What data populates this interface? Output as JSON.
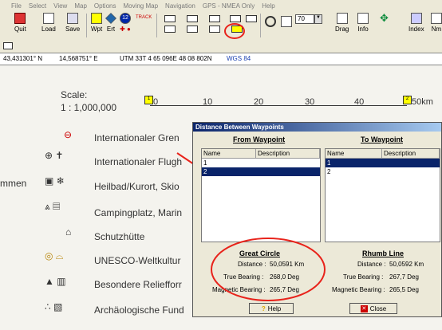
{
  "menu": [
    "File",
    "Select",
    "View",
    "Map",
    "Options",
    "Moving Map",
    "Navigation",
    "GPS - NMEA Only",
    "Help"
  ],
  "toolbar": {
    "quit": "Quit",
    "load": "Load",
    "save": "Save",
    "wpt": "Wpt",
    "ert": "Ert",
    "rte_num": "12",
    "track": "TRACK",
    "zoom": "70",
    "drag": "Drag",
    "info": "Info",
    "index": "Index",
    "nm": "Nm"
  },
  "status": {
    "lat": "43,431301° N",
    "lon": "14,568751° E",
    "utm": "UTM  33T   4 65 096E   48 08 802N",
    "datum": "WGS 84"
  },
  "map": {
    "scale_label": "Scale:",
    "scale_value": "1 : 1,000,000",
    "ruler": [
      "0",
      "10",
      "20",
      "30",
      "40",
      "50km"
    ],
    "left_cut": "mmen",
    "legend": [
      "Internationaler Gren",
      "Internationaler Flugh",
      "Heilbad/Kurort, Skio",
      "Campingplatz, Marin",
      "Schutzhütte",
      "UNESCO-Weltkultur",
      "Besondere Reliefforr",
      "Archäologische Fund"
    ]
  },
  "dialog": {
    "title": "Distance Between Waypoints",
    "from_title": "From Waypoint",
    "to_title": "To Waypoint",
    "col_name": "Name",
    "col_desc": "Description",
    "from_rows": [
      "1",
      "2"
    ],
    "to_rows": [
      "1",
      "2"
    ],
    "great_circle": {
      "title": "Great Circle",
      "distance_label": "Distance :",
      "distance": "50,0591 Km",
      "true_label": "True Bearing :",
      "true": "268,0 Deg",
      "mag_label": "Magnetic Bearing :",
      "mag": "265,7 Deg"
    },
    "rhumb_line": {
      "title": "Rhumb Line",
      "distance_label": "Distance :",
      "distance": "50,0592 Km",
      "true_label": "True Bearing :",
      "true": "267,7 Deg",
      "mag_label": "Magnetic Bearing :",
      "mag": "265,5 Deg"
    },
    "help": "Help",
    "close": "Close"
  },
  "colors": {
    "accent_red": "#e8231b",
    "selection": "#0a246a",
    "title_blue": "#0a246a"
  }
}
